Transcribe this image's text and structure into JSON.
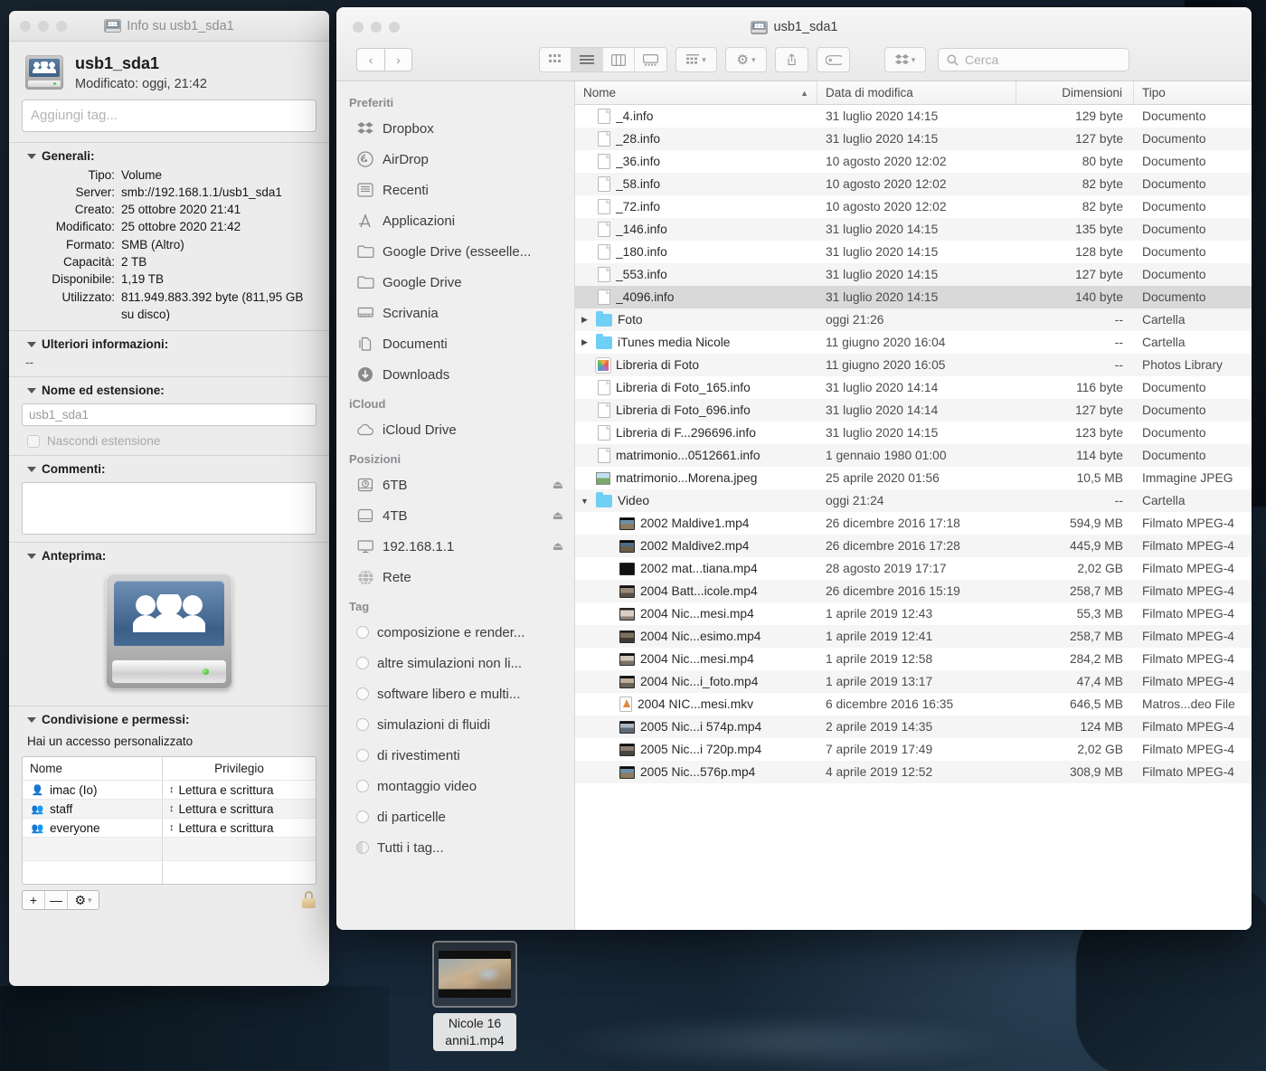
{
  "info_window": {
    "title": "Info su usb1_sda1",
    "icon": "network-volume-icon",
    "name": "usb1_sda1",
    "modified_line": "Modificato: oggi, 21:42",
    "tag_placeholder": "Aggiungi tag...",
    "sections": {
      "generali": {
        "title": "Generali:",
        "rows": [
          {
            "key": "Tipo:",
            "value": "Volume"
          },
          {
            "key": "Server:",
            "value": "smb://192.168.1.1/usb1_sda1"
          },
          {
            "key": "Creato:",
            "value": "25 ottobre 2020 21:41"
          },
          {
            "key": "Modificato:",
            "value": "25 ottobre 2020 21:42"
          },
          {
            "key": "Formato:",
            "value": "SMB (Altro)"
          },
          {
            "key": "Capacità:",
            "value": "2 TB"
          },
          {
            "key": "Disponibile:",
            "value": "1,19 TB"
          },
          {
            "key": "Utilizzato:",
            "value": "811.949.883.392 byte (811,95 GB su disco)"
          }
        ]
      },
      "ulteriori": {
        "title": "Ulteriori informazioni:",
        "value": "--"
      },
      "nome_estensione": {
        "title": "Nome ed estensione:",
        "field_value": "usb1_sda1",
        "checkbox_label": "Nascondi estensione"
      },
      "commenti": {
        "title": "Commenti:",
        "value": ""
      },
      "anteprima": {
        "title": "Anteprima:"
      },
      "permessi": {
        "title": "Condivisione e permessi:",
        "access_note": "Hai un accesso personalizzato",
        "columns": [
          "Nome",
          "Privilegio"
        ],
        "rows": [
          {
            "name": "imac (Io)",
            "icon": "single-user-icon",
            "privilege": "Lettura e scrittura"
          },
          {
            "name": "staff",
            "icon": "two-users-icon",
            "privilege": "Lettura e scrittura"
          },
          {
            "name": "everyone",
            "icon": "three-users-icon",
            "privilege": "Lettura e scrittura"
          }
        ],
        "toolbar": {
          "add": "+",
          "remove": "—",
          "gear": "⚙",
          "chevron": "⌄",
          "lock": "lock-icon"
        }
      }
    }
  },
  "finder_window": {
    "title": "usb1_sda1",
    "title_icon": "network-volume-icon",
    "toolbar": {
      "back": "‹",
      "forward": "›",
      "view_icon": "icon-view",
      "view_list": "list-view",
      "view_column": "column-view",
      "view_gallery": "gallery-view",
      "group": "group-by-button",
      "gear": "action-gear-button",
      "share": "share-button",
      "tag": "tag-button",
      "dropbox": "dropbox-button",
      "search_placeholder": "Cerca"
    },
    "sidebar": [
      {
        "header": "Preferiti",
        "items": [
          {
            "label": "Dropbox",
            "icon": "dropbox-icon"
          },
          {
            "label": "AirDrop",
            "icon": "airdrop-icon"
          },
          {
            "label": "Recenti",
            "icon": "recents-icon"
          },
          {
            "label": "Applicazioni",
            "icon": "applications-icon"
          },
          {
            "label": "Google Drive (esseelle...",
            "icon": "folder-icon"
          },
          {
            "label": "Google Drive",
            "icon": "folder-icon"
          },
          {
            "label": "Scrivania",
            "icon": "desktop-icon"
          },
          {
            "label": "Documenti",
            "icon": "documents-icon"
          },
          {
            "label": "Downloads",
            "icon": "downloads-icon"
          }
        ]
      },
      {
        "header": "iCloud",
        "items": [
          {
            "label": "iCloud Drive",
            "icon": "cloud-icon"
          }
        ]
      },
      {
        "header": "Posizioni",
        "items": [
          {
            "label": "6TB",
            "icon": "timemachine-disk-icon",
            "eject": true
          },
          {
            "label": "4TB",
            "icon": "external-disk-icon",
            "eject": true
          },
          {
            "label": "192.168.1.1",
            "icon": "server-icon",
            "eject": true
          },
          {
            "label": "Rete",
            "icon": "network-globe-icon"
          }
        ]
      },
      {
        "header": "Tag",
        "items": [
          {
            "label": "composizione e render...",
            "icon": "tag-dot-icon"
          },
          {
            "label": "altre simulazioni non li...",
            "icon": "tag-dot-icon"
          },
          {
            "label": "software libero e multi...",
            "icon": "tag-dot-icon"
          },
          {
            "label": "simulazioni di fluidi",
            "icon": "tag-dot-icon"
          },
          {
            "label": "di rivestimenti",
            "icon": "tag-dot-icon"
          },
          {
            "label": "montaggio video",
            "icon": "tag-dot-icon"
          },
          {
            "label": "di particelle",
            "icon": "tag-dot-icon"
          },
          {
            "label": "Tutti i tag...",
            "icon": "all-tags-icon"
          }
        ]
      }
    ],
    "columns": [
      "Nome",
      "Data di modifica",
      "Dimensioni",
      "Tipo"
    ],
    "sort_column": "Nome",
    "sort_direction": "ascending",
    "files": [
      {
        "name": "_4.info",
        "date": "31 luglio 2020 14:15",
        "size": "129 byte",
        "type": "Documento",
        "icon": "document-icon",
        "indent": 0,
        "disclosure": "",
        "selected": false
      },
      {
        "name": "_28.info",
        "date": "31 luglio 2020 14:15",
        "size": "127 byte",
        "type": "Documento",
        "icon": "document-icon",
        "indent": 0,
        "disclosure": "",
        "selected": false
      },
      {
        "name": "_36.info",
        "date": "10 agosto 2020 12:02",
        "size": "80 byte",
        "type": "Documento",
        "icon": "document-icon",
        "indent": 0,
        "disclosure": "",
        "selected": false
      },
      {
        "name": "_58.info",
        "date": "10 agosto 2020 12:02",
        "size": "82 byte",
        "type": "Documento",
        "icon": "document-icon",
        "indent": 0,
        "disclosure": "",
        "selected": false
      },
      {
        "name": "_72.info",
        "date": "10 agosto 2020 12:02",
        "size": "82 byte",
        "type": "Documento",
        "icon": "document-icon",
        "indent": 0,
        "disclosure": "",
        "selected": false
      },
      {
        "name": "_146.info",
        "date": "31 luglio 2020 14:15",
        "size": "135 byte",
        "type": "Documento",
        "icon": "document-icon",
        "indent": 0,
        "disclosure": "",
        "selected": false
      },
      {
        "name": "_180.info",
        "date": "31 luglio 2020 14:15",
        "size": "128 byte",
        "type": "Documento",
        "icon": "document-icon",
        "indent": 0,
        "disclosure": "",
        "selected": false
      },
      {
        "name": "_553.info",
        "date": "31 luglio 2020 14:15",
        "size": "127 byte",
        "type": "Documento",
        "icon": "document-icon",
        "indent": 0,
        "disclosure": "",
        "selected": false
      },
      {
        "name": "_4096.info",
        "date": "31 luglio 2020 14:15",
        "size": "140 byte",
        "type": "Documento",
        "icon": "document-icon",
        "indent": 0,
        "disclosure": "",
        "selected": true
      },
      {
        "name": "Foto",
        "date": "oggi 21:26",
        "size": "--",
        "type": "Cartella",
        "icon": "folder-icon",
        "indent": 0,
        "disclosure": "collapsed",
        "selected": false
      },
      {
        "name": "iTunes media Nicole",
        "date": "11 giugno 2020 16:04",
        "size": "--",
        "type": "Cartella",
        "icon": "folder-icon",
        "indent": 0,
        "disclosure": "collapsed",
        "selected": false
      },
      {
        "name": "Libreria di Foto",
        "date": "11 giugno 2020 16:05",
        "size": "--",
        "type": "Photos Library",
        "icon": "photos-library-icon",
        "indent": 0,
        "disclosure": "",
        "selected": false
      },
      {
        "name": "Libreria di Foto_165.info",
        "date": "31 luglio 2020 14:14",
        "size": "116 byte",
        "type": "Documento",
        "icon": "document-icon",
        "indent": 0,
        "disclosure": "",
        "selected": false
      },
      {
        "name": "Libreria di Foto_696.info",
        "date": "31 luglio 2020 14:14",
        "size": "127 byte",
        "type": "Documento",
        "icon": "document-icon",
        "indent": 0,
        "disclosure": "",
        "selected": false
      },
      {
        "name": "Libreria di F...296696.info",
        "date": "31 luglio 2020 14:15",
        "size": "123 byte",
        "type": "Documento",
        "icon": "document-icon",
        "indent": 0,
        "disclosure": "",
        "selected": false
      },
      {
        "name": "matrimonio...0512661.info",
        "date": "1 gennaio 1980 01:00",
        "size": "114 byte",
        "type": "Documento",
        "icon": "document-icon",
        "indent": 0,
        "disclosure": "",
        "selected": false
      },
      {
        "name": "matrimonio...Morena.jpeg",
        "date": "25 aprile 2020 01:56",
        "size": "10,5 MB",
        "type": "Immagine JPEG",
        "icon": "jpeg-thumb-icon",
        "indent": 0,
        "disclosure": "",
        "selected": false
      },
      {
        "name": "Video",
        "date": "oggi 21:24",
        "size": "--",
        "type": "Cartella",
        "icon": "folder-icon",
        "indent": 0,
        "disclosure": "expanded",
        "selected": false
      },
      {
        "name": "2002 Maldive1.mp4",
        "date": "26 dicembre 2016 17:18",
        "size": "594,9 MB",
        "type": "Filmato MPEG-4",
        "icon": "video-thumb-icon-1",
        "indent": 1,
        "disclosure": "",
        "selected": false
      },
      {
        "name": "2002 Maldive2.mp4",
        "date": "26 dicembre 2016 17:28",
        "size": "445,9 MB",
        "type": "Filmato MPEG-4",
        "icon": "video-thumb-icon-2",
        "indent": 1,
        "disclosure": "",
        "selected": false
      },
      {
        "name": "2002 mat...tiana.mp4",
        "date": "28 agosto 2019 17:17",
        "size": "2,02 GB",
        "type": "Filmato MPEG-4",
        "icon": "video-thumb-icon-3",
        "indent": 1,
        "disclosure": "",
        "selected": false
      },
      {
        "name": "2004 Batt...icole.mp4",
        "date": "26 dicembre 2016 15:19",
        "size": "258,7 MB",
        "type": "Filmato MPEG-4",
        "icon": "video-thumb-icon-4",
        "indent": 1,
        "disclosure": "",
        "selected": false
      },
      {
        "name": "2004 Nic...mesi.mp4",
        "date": "1 aprile 2019 12:43",
        "size": "55,3 MB",
        "type": "Filmato MPEG-4",
        "icon": "video-thumb-icon-5",
        "indent": 1,
        "disclosure": "",
        "selected": false
      },
      {
        "name": "2004 Nic...esimo.mp4",
        "date": "1 aprile 2019 12:41",
        "size": "258,7 MB",
        "type": "Filmato MPEG-4",
        "icon": "video-thumb-icon-6",
        "indent": 1,
        "disclosure": "",
        "selected": false
      },
      {
        "name": "2004 Nic...mesi.mp4",
        "date": "1 aprile 2019 12:58",
        "size": "284,2 MB",
        "type": "Filmato MPEG-4",
        "icon": "video-thumb-icon-7",
        "indent": 1,
        "disclosure": "",
        "selected": false
      },
      {
        "name": "2004 Nic...i_foto.mp4",
        "date": "1 aprile 2019 13:17",
        "size": "47,4 MB",
        "type": "Filmato MPEG-4",
        "icon": "video-thumb-icon-8",
        "indent": 1,
        "disclosure": "",
        "selected": false
      },
      {
        "name": "2004 NIC...mesi.mkv",
        "date": "6 dicembre 2016 16:35",
        "size": "646,5 MB",
        "type": "Matros...deo File",
        "icon": "mkv-icon",
        "indent": 1,
        "disclosure": "",
        "selected": false
      },
      {
        "name": "2005 Nic...i 574p.mp4",
        "date": "2 aprile 2019 14:35",
        "size": "124 MB",
        "type": "Filmato MPEG-4",
        "icon": "video-thumb-icon-9",
        "indent": 1,
        "disclosure": "",
        "selected": false
      },
      {
        "name": "2005 Nic...i 720p.mp4",
        "date": "7 aprile 2019 17:49",
        "size": "2,02 GB",
        "type": "Filmato MPEG-4",
        "icon": "video-thumb-icon-10",
        "indent": 1,
        "disclosure": "",
        "selected": false
      },
      {
        "name": "2005 Nic...576p.mp4",
        "date": "4 aprile 2019 12:52",
        "size": "308,9 MB",
        "type": "Filmato MPEG-4",
        "icon": "video-thumb-icon-1",
        "indent": 1,
        "disclosure": "",
        "selected": false
      }
    ]
  },
  "desktop": {
    "selected_item": {
      "label_line1": "Nicole 16",
      "label_line2": "anni1.mp4",
      "icon": "video-file-thumbnail"
    }
  }
}
